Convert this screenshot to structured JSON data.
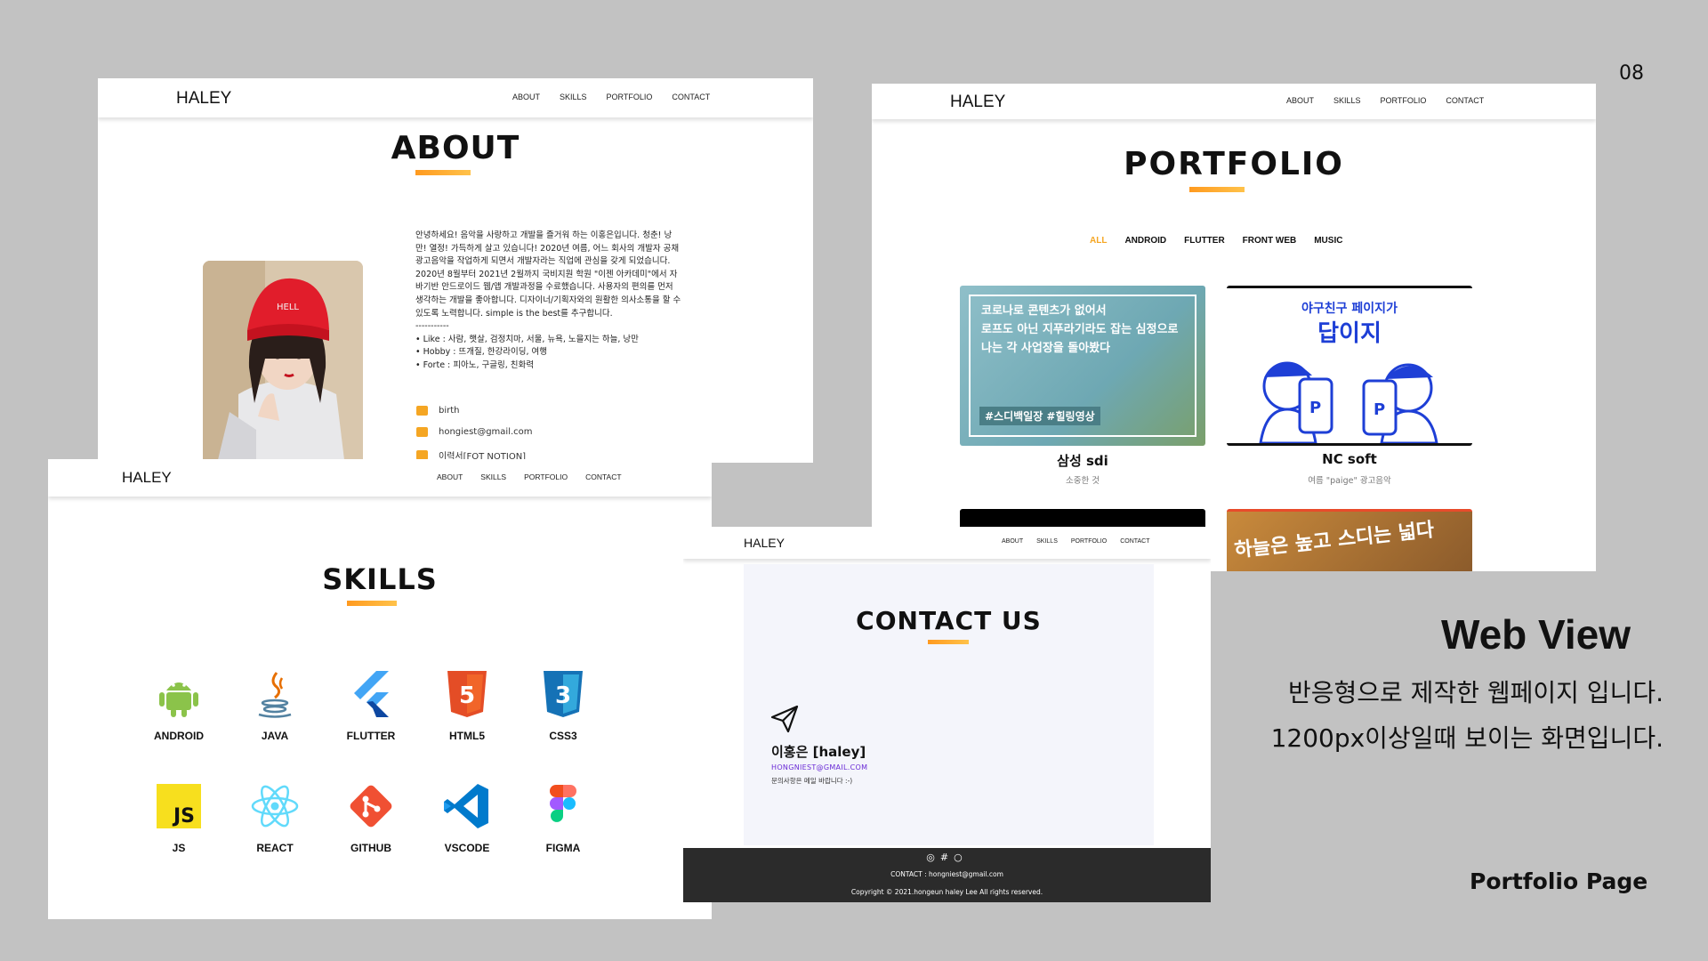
{
  "page_number": "08",
  "nav_menu": [
    "ABOUT",
    "SKILLS",
    "PORTFOLIO",
    "CONTACT"
  ],
  "logo": "HALEY",
  "about": {
    "title": "ABOUT",
    "paragraph": "안녕하세요! 음악을 사랑하고 개발을 즐거워 하는 이홍은입니다. 청춘! 낭만! 열정! 가득하게 살고 있습니다! 2020년 여름, 어느 회사의 개발자 공채 광고음악을 작업하게 되면서 개발자라는 직업에 관심을 갖게 되었습니다. 2020년 8월부터 2021년 2월까지 국비지원 학원 \"이젠 아카데미\"에서 자바기반 안드로이드 웹/앱 개발과정을 수료했습니다. 사용자의 편의를 먼저 생각하는 개발을 좋아합니다. 디자이너/기획자와의 원활한 의사소통을 할 수 있도록 노력합니다. simple is the best를 추구합니다.",
    "divider": "-----------",
    "likes": "• Like : 사람, 햇살, 검정치마, 서울, 뉴욕, 노을지는 하늘, 낭만",
    "hobby": "• Hobby : 뜨개질, 한강라이딩, 여행",
    "forte": "• Forte : 피아노, 구글링, 친화력",
    "info": [
      "birth",
      "hongiest@gmail.com",
      "이력서[FOT NOTION]"
    ],
    "photo_text": "HELL"
  },
  "portfolio": {
    "title": "PORTFOLIO",
    "filters": [
      "ALL",
      "ANDROID",
      "FLUTTER",
      "FRONT WEB",
      "MUSIC"
    ],
    "cards": [
      {
        "title": "삼성 sdi",
        "subtitle": "소중한 것",
        "lines": [
          "코로나로 콘텐츠가 없어서",
          "로프도 아닌 지푸라기라도 잡는 심정으로",
          "나는 각 사업장을 돌아봤다"
        ],
        "hashtags": "#스디백일장 #힐링영상"
      },
      {
        "title": "NC soft",
        "subtitle": "여름 \"paige\" 광고음악",
        "heading": "야구친구 페이지가",
        "big": "답이지"
      },
      {
        "banner": "하늘은 높고 스디는 넓다"
      }
    ]
  },
  "skills": {
    "title": "SKILLS",
    "items": [
      "ANDROID",
      "JAVA",
      "FLUTTER",
      "HTML5",
      "CSS3",
      "JS",
      "REACT",
      "GITHUB",
      "VSCODE",
      "FIGMA"
    ],
    "js_glyph": "JS",
    "html_glyph": "5",
    "css_glyph": "3"
  },
  "contact": {
    "title": "CONTACT US",
    "name": "이홍은 [haley]",
    "email": "HONGNIEST@GMAIL.COM",
    "note": "문의사항은 메일 바랍니다 :-)",
    "footer_icons": [
      "◎",
      "#",
      "○"
    ],
    "footer_contact": "CONTACT : hongniest@gmail.com",
    "copyright": "Copyright © 2021.hongeun haley Lee All rights reserved."
  },
  "panel": {
    "title": "Web View",
    "desc1": "반응형으로 제작한 웹페이지 입니다.",
    "desc2": "1200px이상일때 보이는 화면입니다.",
    "label": "Portfolio Page"
  },
  "colors": {
    "accent": "#f5a623",
    "background": "#c2c2c2",
    "footer": "#2b2b2b"
  }
}
